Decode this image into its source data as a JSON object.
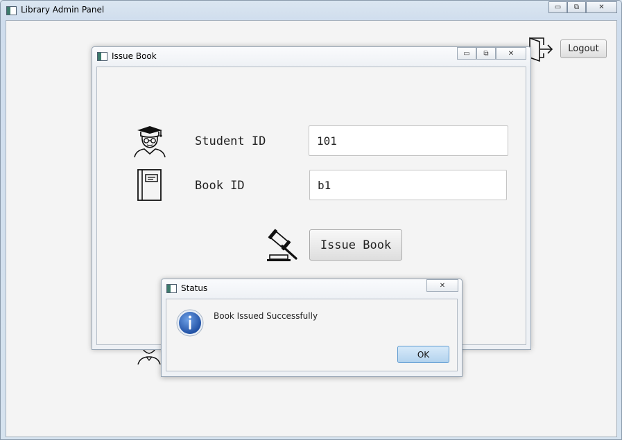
{
  "main_window": {
    "title": "Library Admin Panel",
    "logout_label": "Logout",
    "controls": {
      "minimize": "▭",
      "maximize": "⧉",
      "close": "✕"
    }
  },
  "issue_window": {
    "title": "Issue Book",
    "controls": {
      "minimize": "▭",
      "maximize": "⧉",
      "close": "✕"
    },
    "student_id_label": "Student ID",
    "student_id_value": "101",
    "book_id_label": "Book ID",
    "book_id_value": "b1",
    "issue_button_label": "Issue Book"
  },
  "status_dialog": {
    "title": "Status",
    "close": "✕",
    "message": "Book Issued Successfully",
    "ok_label": "OK"
  },
  "icons": {
    "student": "student-graduate-icon",
    "book": "book-icon",
    "gavel": "gavel-icon",
    "logout": "logout-door-icon",
    "info": "info-icon"
  },
  "colors": {
    "info_blue": "#2b63b8",
    "ok_button": "#b3d3ee"
  }
}
